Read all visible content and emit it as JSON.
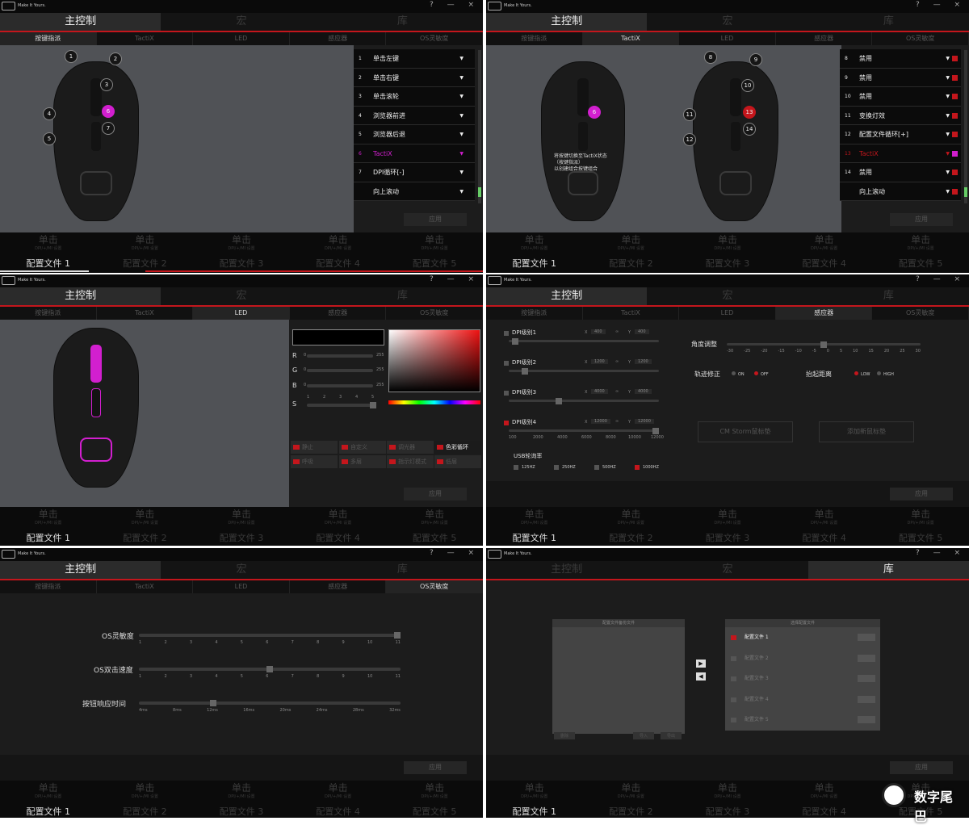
{
  "app": {
    "brand": "Make It Yours.",
    "window_controls": "? — ×"
  },
  "main_tabs": [
    "主控制",
    "宏",
    "库"
  ],
  "sub_tabs": [
    "按键指派",
    "TactiX",
    "LED",
    "感应器",
    "OS灵敏度"
  ],
  "bottom_bar": [
    {
      "label": "单击",
      "sub": "DPI/+/MI 设置"
    },
    {
      "label": "单击",
      "sub": "DPI/+/MI 设置"
    },
    {
      "label": "单击",
      "sub": "DPI/+/MI 设置"
    },
    {
      "label": "单击",
      "sub": "DPI/+/MI 设置"
    },
    {
      "label": "单击",
      "sub": "DPI/+/MI 设置"
    }
  ],
  "profiles": [
    "配置文件 1",
    "配置文件 2",
    "配置文件 3",
    "配置文件 4",
    "配置文件 5"
  ],
  "apply_label": "应用",
  "button_assign": {
    "callouts": [
      "1",
      "2",
      "3",
      "4",
      "5",
      "6",
      "7"
    ],
    "rows": [
      {
        "num": "1",
        "label": "单击左键"
      },
      {
        "num": "2",
        "label": "单击右键"
      },
      {
        "num": "3",
        "label": "单击滚轮"
      },
      {
        "num": "4",
        "label": "浏览器前进"
      },
      {
        "num": "5",
        "label": "浏览器后退"
      },
      {
        "num": "6",
        "label": "TactiX"
      },
      {
        "num": "7",
        "label": "DPI循环[-]"
      },
      {
        "num": "",
        "label": "向上滚动"
      }
    ]
  },
  "tactix": {
    "callouts": [
      "6",
      "8",
      "9",
      "10",
      "11",
      "12",
      "13",
      "14"
    ],
    "hint": "将按键切换至TactiX状态\n（按键指派）\n以创建组合按键组合",
    "rows": [
      {
        "num": "8",
        "label": "禁用"
      },
      {
        "num": "9",
        "label": "禁用"
      },
      {
        "num": "10",
        "label": "禁用"
      },
      {
        "num": "11",
        "label": "变换灯效"
      },
      {
        "num": "12",
        "label": "配置文件循环[+]"
      },
      {
        "num": "13",
        "label": "TactiX"
      },
      {
        "num": "14",
        "label": "禁用"
      },
      {
        "num": "",
        "label": "向上滚动"
      }
    ]
  },
  "led": {
    "channels": [
      {
        "name": "R",
        "min": "0",
        "max": "255"
      },
      {
        "name": "G",
        "min": "0",
        "max": "255"
      },
      {
        "name": "B",
        "min": "0",
        "max": "255"
      }
    ],
    "speed": {
      "name": "S",
      "ticks": [
        "1",
        "2",
        "3",
        "4",
        "5"
      ]
    },
    "modes": [
      "静止",
      "自定义",
      "调光器",
      "色彩循环",
      "呼吸",
      "多层",
      "指示灯模式",
      "低层"
    ]
  },
  "sensor": {
    "dpi_levels": [
      {
        "label": "DPI级别1",
        "x": "400",
        "y": "400"
      },
      {
        "label": "DPI级别2",
        "x": "1200",
        "y": "1200"
      },
      {
        "label": "DPI级别3",
        "x": "4000",
        "y": "4000"
      },
      {
        "label": "DPI级别4",
        "x": "12000",
        "y": "12000"
      }
    ],
    "x_label": "X",
    "y_label": "Y",
    "dpi_ticks": [
      "100",
      "2000",
      "4000",
      "6000",
      "8000",
      "10000",
      "12000"
    ],
    "usb_rate_label": "USB轮询率",
    "usb_rates": [
      "125HZ",
      "250HZ",
      "500HZ",
      "1000HZ"
    ],
    "angle_label": "角度调整",
    "angle_ticks": [
      "-30",
      "-25",
      "-20",
      "-15",
      "-10",
      "-5",
      "0",
      "5",
      "10",
      "15",
      "20",
      "25",
      "30"
    ],
    "snap_label": "轨迹修正",
    "snap_on": "ON",
    "snap_off": "OFF",
    "lod_label": "抬起距离",
    "lod_low": "LOW",
    "lod_high": "HIGH",
    "pad_a": "CM Storm鼠标垫",
    "pad_b": "添加新鼠标垫"
  },
  "os": {
    "sens_label": "OS灵敏度",
    "dbl_label": "OS双击速度",
    "resp_label": "按钮响应时间",
    "scale_ticks": [
      "1",
      "2",
      "3",
      "4",
      "5",
      "6",
      "7",
      "8",
      "9",
      "10",
      "11"
    ],
    "resp_ticks": [
      "4ms",
      "8ms",
      "12ms",
      "16ms",
      "20ms",
      "24ms",
      "28ms",
      "32ms"
    ]
  },
  "library": {
    "left_title": "配置文件备份文件",
    "right_title": "选择配置文件",
    "right_items": [
      "配置文件 1",
      "配置文件 2",
      "配置文件 3",
      "配置文件 4",
      "配置文件 5"
    ],
    "btn_delete": "删除",
    "btn_import": "导入",
    "btn_export": "导出"
  },
  "watermark": "数字尾巴",
  "colors": {
    "accent": "#c4161c",
    "magenta": "#d21fcf"
  }
}
